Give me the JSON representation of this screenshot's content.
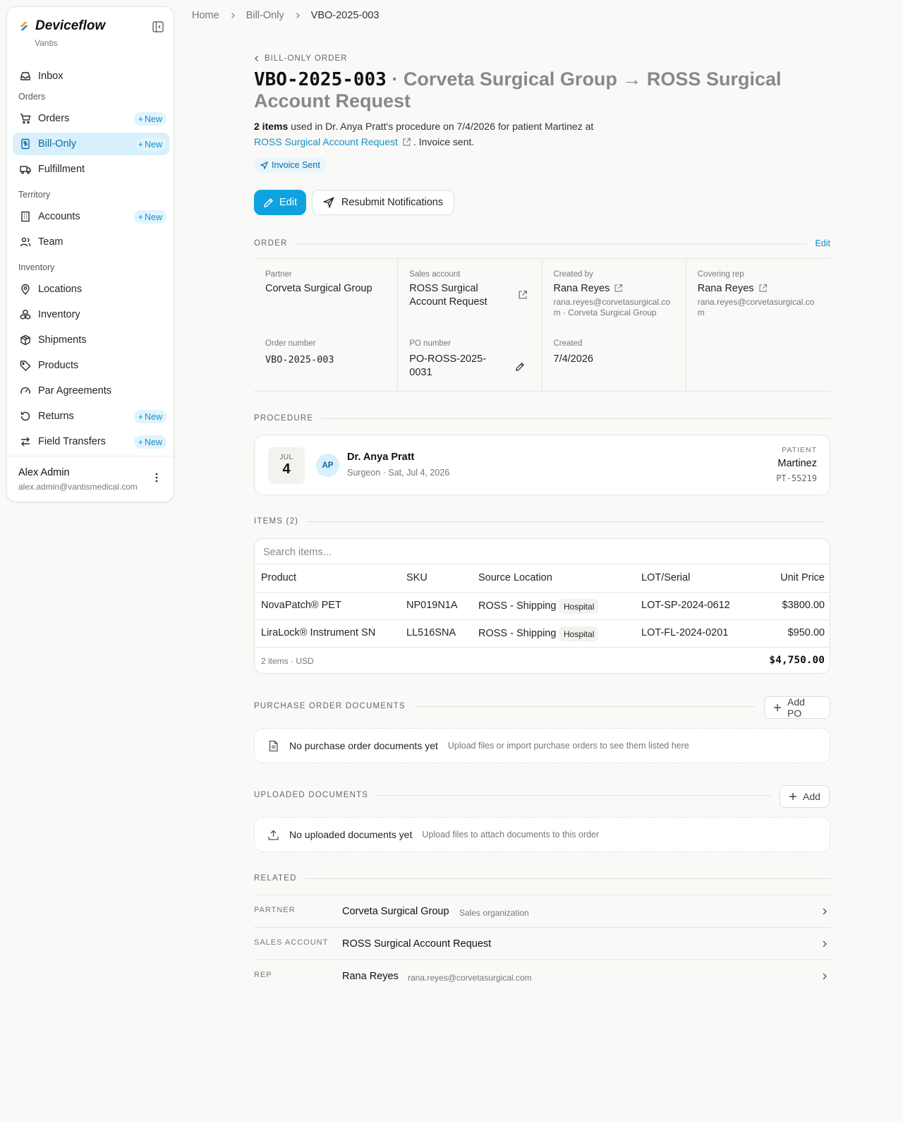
{
  "brand": {
    "name": "Deviceflow",
    "sub": "Vantis"
  },
  "sidebar": {
    "new_label": "New",
    "sections": {
      "orders": "Orders",
      "territory": "Territory",
      "inventory": "Inventory"
    },
    "items": {
      "inbox": "Inbox",
      "orders": "Orders",
      "bill_only": "Bill-Only",
      "fulfillment": "Fulfillment",
      "accounts": "Accounts",
      "team": "Team",
      "locations": "Locations",
      "inventory": "Inventory",
      "shipments": "Shipments",
      "products": "Products",
      "par_agreements": "Par Agreements",
      "returns": "Returns",
      "field_transfers": "Field Transfers"
    },
    "user": {
      "name": "Alex Admin",
      "email": "alex.admin@vantismedical.com"
    }
  },
  "breadcrumb": {
    "home": "Home",
    "section": "Bill-Only",
    "current": "VBO-2025-003"
  },
  "header": {
    "back_label": "BILL-ONLY ORDER",
    "code": "VBO-2025-003",
    "title_rest": "· Corveta Surgical Group → ROSS Surgical Account Request",
    "items_count": "2 items",
    "desc_mid": "used in Dr. Anya Pratt's procedure on 7/4/2026 for patient Martinez at",
    "desc_link": "ROSS Surgical Account Request",
    "desc_end": ". Invoice sent.",
    "status": "Invoice Sent",
    "edit_button": "Edit",
    "resubmit_button": "Resubmit Notifications"
  },
  "order": {
    "section_label": "ORDER",
    "edit_link": "Edit",
    "partner_label": "Partner",
    "partner": "Corveta Surgical Group",
    "sales_account_label": "Sales account",
    "sales_account": "ROSS Surgical Account Request",
    "created_by_label": "Created by",
    "created_by": "Rana Reyes",
    "created_by_sub": "rana.reyes@corvetasurgical.com · Corveta Surgical Group",
    "covering_rep_label": "Covering rep",
    "covering_rep": "Rana Reyes",
    "covering_rep_email": "rana.reyes@corvetasurgical.com",
    "order_number_label": "Order number",
    "order_number": "VBO-2025-003",
    "po_number_label": "PO number",
    "po_number": "PO-ROSS-2025-0031",
    "created_label": "Created",
    "created": "7/4/2026"
  },
  "procedure": {
    "section_label": "PROCEDURE",
    "month": "JUL",
    "day": "4",
    "initials": "AP",
    "doctor": "Dr. Anya Pratt",
    "sub": "Surgeon · Sat, Jul 4, 2026",
    "patient_label": "PATIENT",
    "patient": "Martinez",
    "patient_id": "PT-55219"
  },
  "items": {
    "section_label": "ITEMS (2)",
    "search_placeholder": "Search items...",
    "columns": {
      "product": "Product",
      "sku": "SKU",
      "source": "Source Location",
      "lot": "LOT/Serial",
      "price": "Unit Price"
    },
    "rows": [
      {
        "product": "NovaPatch® PET",
        "sku": "NP019N1A",
        "source": "ROSS - Shipping",
        "tag": "Hospital",
        "lot": "LOT-SP-2024-0612",
        "price": "$3800.00"
      },
      {
        "product": "LiraLock® Instrument SN",
        "sku": "LL516SNA",
        "source": "ROSS - Shipping",
        "tag": "Hospital",
        "lot": "LOT-FL-2024-0201",
        "price": "$950.00"
      }
    ],
    "footer_left": "2 items · USD",
    "total": "$4,750.00"
  },
  "po_docs": {
    "section_label": "PURCHASE ORDER DOCUMENTS",
    "add_label": "Add PO",
    "empty_title": "No purchase order documents yet",
    "empty_sub": "Upload files or import purchase orders to see them listed here"
  },
  "uploaded_docs": {
    "section_label": "UPLOADED DOCUMENTS",
    "add_label": "Add",
    "empty_title": "No uploaded documents yet",
    "empty_sub": "Upload files to attach documents to this order"
  },
  "related": {
    "section_label": "RELATED",
    "partner_label": "PARTNER",
    "partner": "Corveta Surgical Group",
    "partner_sub": "Sales organization",
    "account_label": "SALES ACCOUNT",
    "account": "ROSS Surgical Account Request",
    "rep_label": "REP",
    "rep": "Rana Reyes",
    "rep_email": "rana.reyes@corvetasurgical.com"
  },
  "colors": {
    "accent": "#0ea2e0",
    "link": "#1a8ec8",
    "active_bg": "#d7f0fb"
  }
}
